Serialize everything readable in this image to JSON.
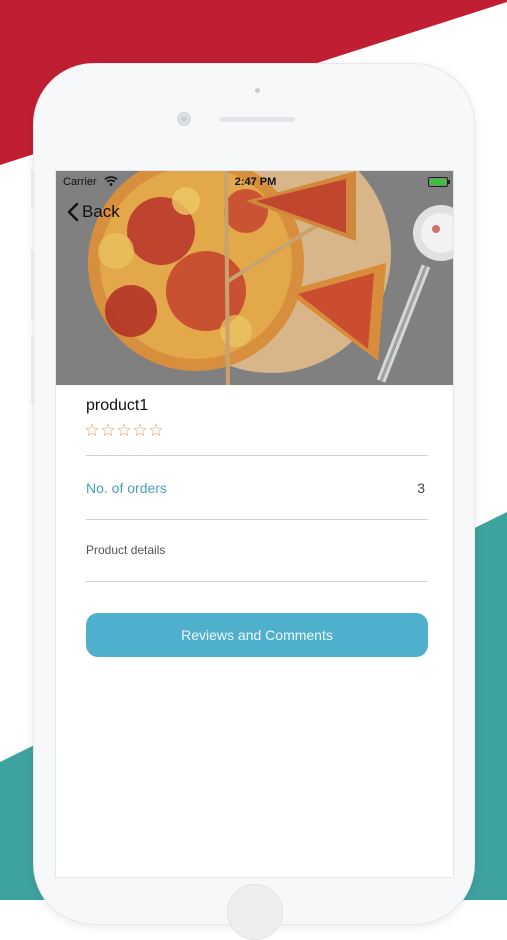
{
  "status_bar": {
    "carrier": "Carrier",
    "time": "2:47 PM"
  },
  "nav": {
    "back_label": "Back"
  },
  "product": {
    "name": "product1",
    "rating": 0,
    "rating_max": 5,
    "orders_label": "No. of orders",
    "orders_value": "3",
    "details_label": "Product details"
  },
  "actions": {
    "reviews_label": "Reviews and Comments"
  },
  "colors": {
    "accent": "#4fb0cd",
    "orders_text": "#4a9fbc",
    "background_red": "#c01f33",
    "background_teal": "#3ea29f",
    "star_outline": "#d9c49a"
  },
  "icons": [
    "wifi-icon",
    "battery-icon",
    "back-chevron-icon",
    "star-icon"
  ]
}
